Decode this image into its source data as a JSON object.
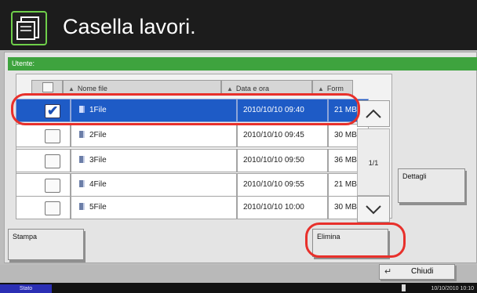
{
  "header": {
    "title": "Casella lavori."
  },
  "user_bar": {
    "label": "Utente:"
  },
  "columns": [
    {
      "label": "Nome file"
    },
    {
      "label": "Data e ora"
    },
    {
      "label": "Form"
    }
  ],
  "rows": [
    {
      "name": "1File",
      "date": "2010/10/10 09:40",
      "size": "21 MB",
      "checked": true
    },
    {
      "name": "2File",
      "date": "2010/10/10 09:45",
      "size": "30 MB",
      "checked": false
    },
    {
      "name": "3File",
      "date": "2010/10/10 09:50",
      "size": "36 MB",
      "checked": false
    },
    {
      "name": "4File",
      "date": "2010/10/10 09:55",
      "size": "21 MB",
      "checked": false
    },
    {
      "name": "5File",
      "date": "2010/10/10 10:00",
      "size": "30 MB",
      "checked": false
    }
  ],
  "pager": {
    "page": "1/1"
  },
  "buttons": {
    "details": "Dettagli",
    "print": "Stampa",
    "delete": "Elimina",
    "close": "Chiudi"
  },
  "status": {
    "stato": "Stato",
    "datetime": "10/10/2010 10:10"
  },
  "icons": {
    "app": "job-box-icon",
    "scroll_up": "chevron-up-icon",
    "scroll_down": "chevron-down-icon",
    "file": "document-icon",
    "enter": "enter-key-icon"
  },
  "colors": {
    "title_bar": "#1c1c1c",
    "accent_green": "#3ea33e",
    "selection": "#1e5bc6",
    "highlight": "#e8302b",
    "stato": "#2b2fb4"
  }
}
